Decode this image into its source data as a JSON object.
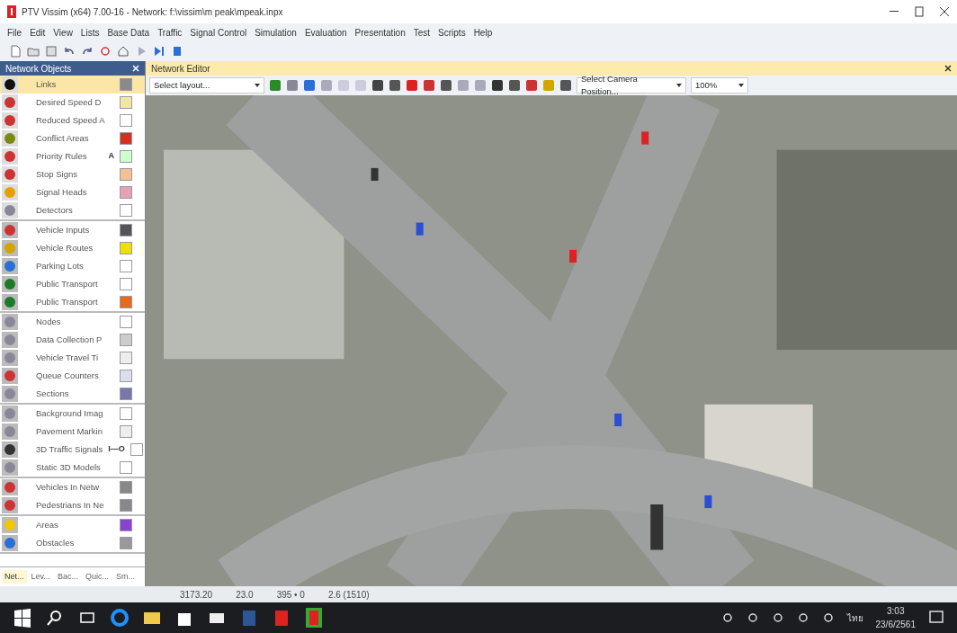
{
  "window": {
    "title": "PTV Vissim (x64) 7.00-16 - Network: f:\\vissim\\m peak\\mpeak.inpx"
  },
  "menu": [
    "File",
    "Edit",
    "View",
    "Lists",
    "Base Data",
    "Traffic",
    "Signal Control",
    "Simulation",
    "Evaluation",
    "Presentation",
    "Test",
    "Scripts",
    "Help"
  ],
  "network_objects": {
    "title": "Network Objects",
    "groups": [
      {
        "items": [
          {
            "label": "Links",
            "selected": true
          },
          {
            "label": "Desired Speed D",
            "selected": false
          },
          {
            "label": "Reduced Speed A",
            "selected": false
          },
          {
            "label": "Conflict Areas",
            "selected": false
          },
          {
            "label": "Priority Rules",
            "selected": false,
            "mark": "A"
          },
          {
            "label": "Stop Signs",
            "selected": false
          },
          {
            "label": "Signal Heads",
            "selected": false
          },
          {
            "label": "Detectors",
            "selected": false
          }
        ]
      },
      {
        "items": [
          {
            "label": "Vehicle Inputs",
            "selected": false
          },
          {
            "label": "Vehicle Routes",
            "selected": false
          },
          {
            "label": "Parking Lots",
            "selected": false
          },
          {
            "label": "Public Transport",
            "selected": false
          },
          {
            "label": "Public Transport",
            "selected": false
          }
        ]
      },
      {
        "items": [
          {
            "label": "Nodes",
            "selected": false
          },
          {
            "label": "Data Collection P",
            "selected": false
          },
          {
            "label": "Vehicle Travel Ti",
            "selected": false
          },
          {
            "label": "Queue Counters",
            "selected": false
          },
          {
            "label": "Sections",
            "selected": false
          }
        ]
      },
      {
        "items": [
          {
            "label": "Background Imag",
            "selected": false
          },
          {
            "label": "Pavement Markin",
            "selected": false
          },
          {
            "label": "3D Traffic Signals",
            "selected": false,
            "mark": "I—O"
          },
          {
            "label": "Static 3D Models",
            "selected": false
          }
        ]
      },
      {
        "items": [
          {
            "label": "Vehicles In Netw",
            "selected": false
          },
          {
            "label": "Pedestrians In Ne",
            "selected": false
          }
        ]
      },
      {
        "items": [
          {
            "label": "Areas",
            "selected": false
          },
          {
            "label": "Obstacles",
            "selected": false
          }
        ]
      }
    ],
    "tabs": [
      {
        "label": "Net...",
        "selected": true
      },
      {
        "label": "Lev...",
        "selected": false
      },
      {
        "label": "Bac...",
        "selected": false
      },
      {
        "label": "Quic...",
        "selected": false
      },
      {
        "label": "Sm...",
        "selected": false
      }
    ]
  },
  "editor": {
    "title": "Network Editor",
    "layout_select": "Select layout...",
    "camera_select": "Select Camera Position...",
    "zoom_select": "100%"
  },
  "status_bar": [
    "3173.20",
    "23.0",
    "395 • 0",
    "2.6 (1510)"
  ],
  "taskbar": {
    "language": "ไทย",
    "time": "3:03",
    "date": "23/6/2561"
  }
}
